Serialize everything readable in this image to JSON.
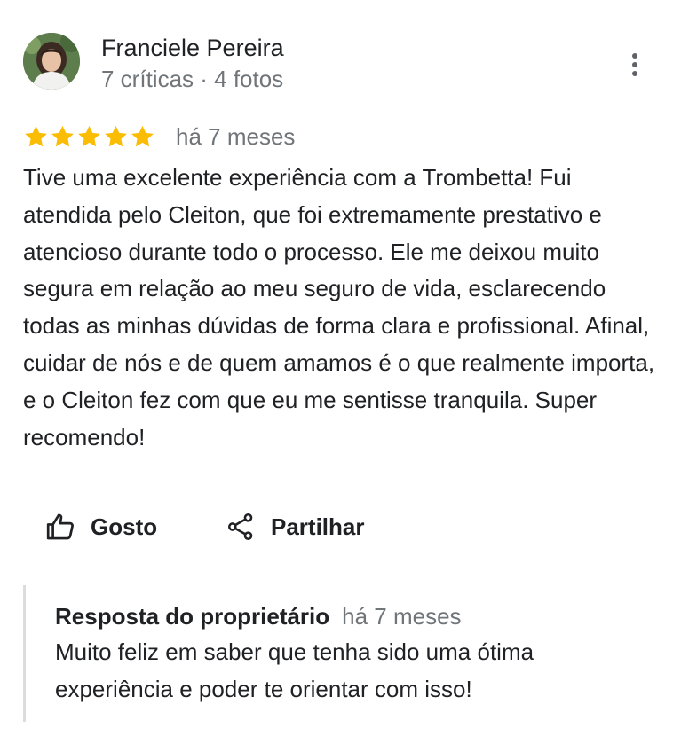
{
  "reviewer": {
    "name": "Franciele Pereira",
    "meta": "7 críticas · 4 fotos"
  },
  "review": {
    "rating": 5,
    "max_rating": 5,
    "date": "há 7 meses",
    "text": "Tive uma excelente experiência com a Trombetta! Fui atendida pelo Cleiton, que foi extremamente prestativo e atencioso durante todo o processo. Ele me deixou muito segura em relação ao meu seguro de vida, esclarecendo todas as minhas dúvidas de forma clara e profissional. Afinal, cuidar de nós e de quem amamos é o que realmente importa, e o Cleiton fez com que eu me sentisse tranquila. Super recomendo!"
  },
  "actions": {
    "like_label": "Gosto",
    "share_label": "Partilhar"
  },
  "owner_reply": {
    "title": "Resposta do proprietário",
    "date": "há 7 meses",
    "text": "Muito feliz em saber que tenha sido uma ótima experiência e poder te orientar com isso!"
  },
  "colors": {
    "star": "#fbbc04",
    "text_primary": "#202124",
    "text_secondary": "#70757a",
    "reply_border": "#dadce0"
  },
  "icons": {
    "menu": "more-vert-icon",
    "like": "thumb-up-icon",
    "share": "share-icon",
    "rating": "star-icon"
  }
}
